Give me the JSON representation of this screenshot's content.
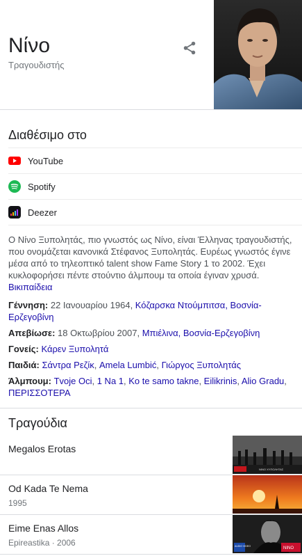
{
  "header": {
    "title": "Νίνο",
    "subtitle": "Τραγουδιστής"
  },
  "icons": {
    "share": "share-icon",
    "youtube": "youtube-icon",
    "spotify": "spotify-icon",
    "deezer": "deezer-icon"
  },
  "available": {
    "title": "Διαθέσιμο στο",
    "items": [
      {
        "label": "YouTube",
        "icon": "youtube-icon",
        "color": "#ff0000"
      },
      {
        "label": "Spotify",
        "icon": "spotify-icon",
        "color": "#1db954"
      },
      {
        "label": "Deezer",
        "icon": "deezer-icon",
        "color": "#121216"
      }
    ]
  },
  "description": {
    "text": "Ο Νίνο Ξυπολητάς, πιο γνωστός ως Νίνο, είναι Έλληνας τραγουδιστής, που ονομάζεται κανονικά Στέφανος Ξυπολητάς. Ευρέως γνωστός έγινε μέσα από το τηλεοπτικό talent show Fame Story 1 το 2002. Έχει κυκλοφορήσει πέντε στούντιο άλμπουμ τα οποία έγιναν χρυσά.",
    "source": "Βικιπαίδεια"
  },
  "facts": {
    "birth": {
      "label": "Γέννηση:",
      "text": " 22 Ιανουαρίου 1964, ",
      "link": "Κόζαρσκα Ντούμπιτσα, Βοσνία-Ερζεγοβίνη"
    },
    "death": {
      "label": "Απεβίωσε:",
      "text": " 18 Οκτωβρίου 2007, ",
      "link": "Μπιέλινα, Βοσνία-Ερζεγοβίνη"
    },
    "parents": {
      "label": "Γονείς:",
      "link": "Κάρεν Ξυπολητά"
    },
    "children": {
      "label": "Παιδιά:",
      "links": [
        "Σάντρα Ρεζίκ",
        "Amela Lumbić",
        "Γιώργος Ξυπολητάς"
      ]
    },
    "albums": {
      "label": "Άλμπουμ:",
      "links": [
        "Tvoje Oci",
        "1 Na 1",
        "Ko te samo takne",
        "Eilikrinis",
        "Alio Gradu"
      ],
      "more": "ΠΕΡΙΣΣΟΤΕΡΑ"
    }
  },
  "songs": {
    "title": "Τραγούδια",
    "items": [
      {
        "name": "Megalos Erotas",
        "meta": ""
      },
      {
        "name": "Od Kada Te Nema",
        "meta": "1995"
      },
      {
        "name": "Eime Enas Allos",
        "meta": "Epireastika · 2006"
      }
    ],
    "thumb_texts": [
      "ΝΙΝΟ ΧΥΠΟΛΗΤΑΣ",
      "AUDIO VIDEO",
      "ΝΙΝΟ"
    ]
  },
  "colors": {
    "link": "#1a0dab",
    "text": "#202124",
    "muted": "#70757a",
    "divider": "#dadce0"
  }
}
